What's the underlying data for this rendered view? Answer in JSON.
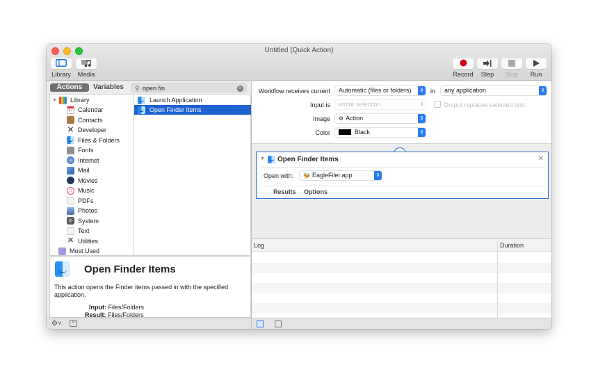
{
  "window": {
    "title": "Untitled (Quick Action)"
  },
  "toolbar": {
    "left": [
      {
        "label": "Library",
        "icon": "library-icon"
      },
      {
        "label": "Media",
        "icon": "media-icon"
      }
    ],
    "right": [
      {
        "label": "Record",
        "icon": "record-icon",
        "enabled": true
      },
      {
        "label": "Step",
        "icon": "step-icon",
        "enabled": true
      },
      {
        "label": "Stop",
        "icon": "stop-icon",
        "enabled": false
      },
      {
        "label": "Run",
        "icon": "run-icon",
        "enabled": true
      }
    ]
  },
  "left_panel": {
    "tabs": {
      "actions": "Actions",
      "variables": "Variables"
    },
    "search": {
      "value": "open fin",
      "icon": "search-icon"
    },
    "library": {
      "root": "Library",
      "items": [
        {
          "label": "Calendar",
          "icon": "calendar-icon"
        },
        {
          "label": "Contacts",
          "icon": "contacts-icon"
        },
        {
          "label": "Developer",
          "icon": "developer-icon"
        },
        {
          "label": "Files & Folders",
          "icon": "finder-icon"
        },
        {
          "label": "Fonts",
          "icon": "fonts-icon"
        },
        {
          "label": "Internet",
          "icon": "internet-icon"
        },
        {
          "label": "Mail",
          "icon": "mail-icon"
        },
        {
          "label": "Movies",
          "icon": "movies-icon"
        },
        {
          "label": "Music",
          "icon": "music-icon"
        },
        {
          "label": "PDFs",
          "icon": "pdf-icon"
        },
        {
          "label": "Photos",
          "icon": "photos-icon"
        },
        {
          "label": "System",
          "icon": "system-icon"
        },
        {
          "label": "Text",
          "icon": "text-icon"
        },
        {
          "label": "Utilities",
          "icon": "utilities-icon"
        }
      ],
      "most_used": "Most Used"
    },
    "actions": [
      {
        "label": "Launch Application",
        "selected": false
      },
      {
        "label": "Open Finder Items",
        "selected": true
      }
    ],
    "description": {
      "title": "Open Finder Items",
      "text": "This action opens the Finder items passed in with the specified application.",
      "input_label": "Input:",
      "input_value": "Files/Folders",
      "result_label": "Result:",
      "result_value": "Files/Folders"
    }
  },
  "workflow_settings": {
    "receives_label": "Workflow receives current",
    "receives_value": "Automatic (files or folders)",
    "in_label": "in",
    "in_value": "any application",
    "input_is_label": "Input is",
    "input_is_value": "entire selection",
    "output_replaces_label": "Output replaces selected text",
    "output_replaces_checked": false,
    "image_label": "Image",
    "image_value": "Action",
    "color_label": "Color",
    "color_value": "Black",
    "color_swatch": "#000000"
  },
  "action_card": {
    "title": "Open Finder Items",
    "open_with_label": "Open with:",
    "open_with_value": "EagleFiler.app",
    "tabs": [
      "Results",
      "Options"
    ]
  },
  "log": {
    "columns": [
      "Log",
      "Duration"
    ],
    "rows": []
  },
  "colors": {
    "accent": "#1c62d0",
    "record": "#d0021b"
  }
}
